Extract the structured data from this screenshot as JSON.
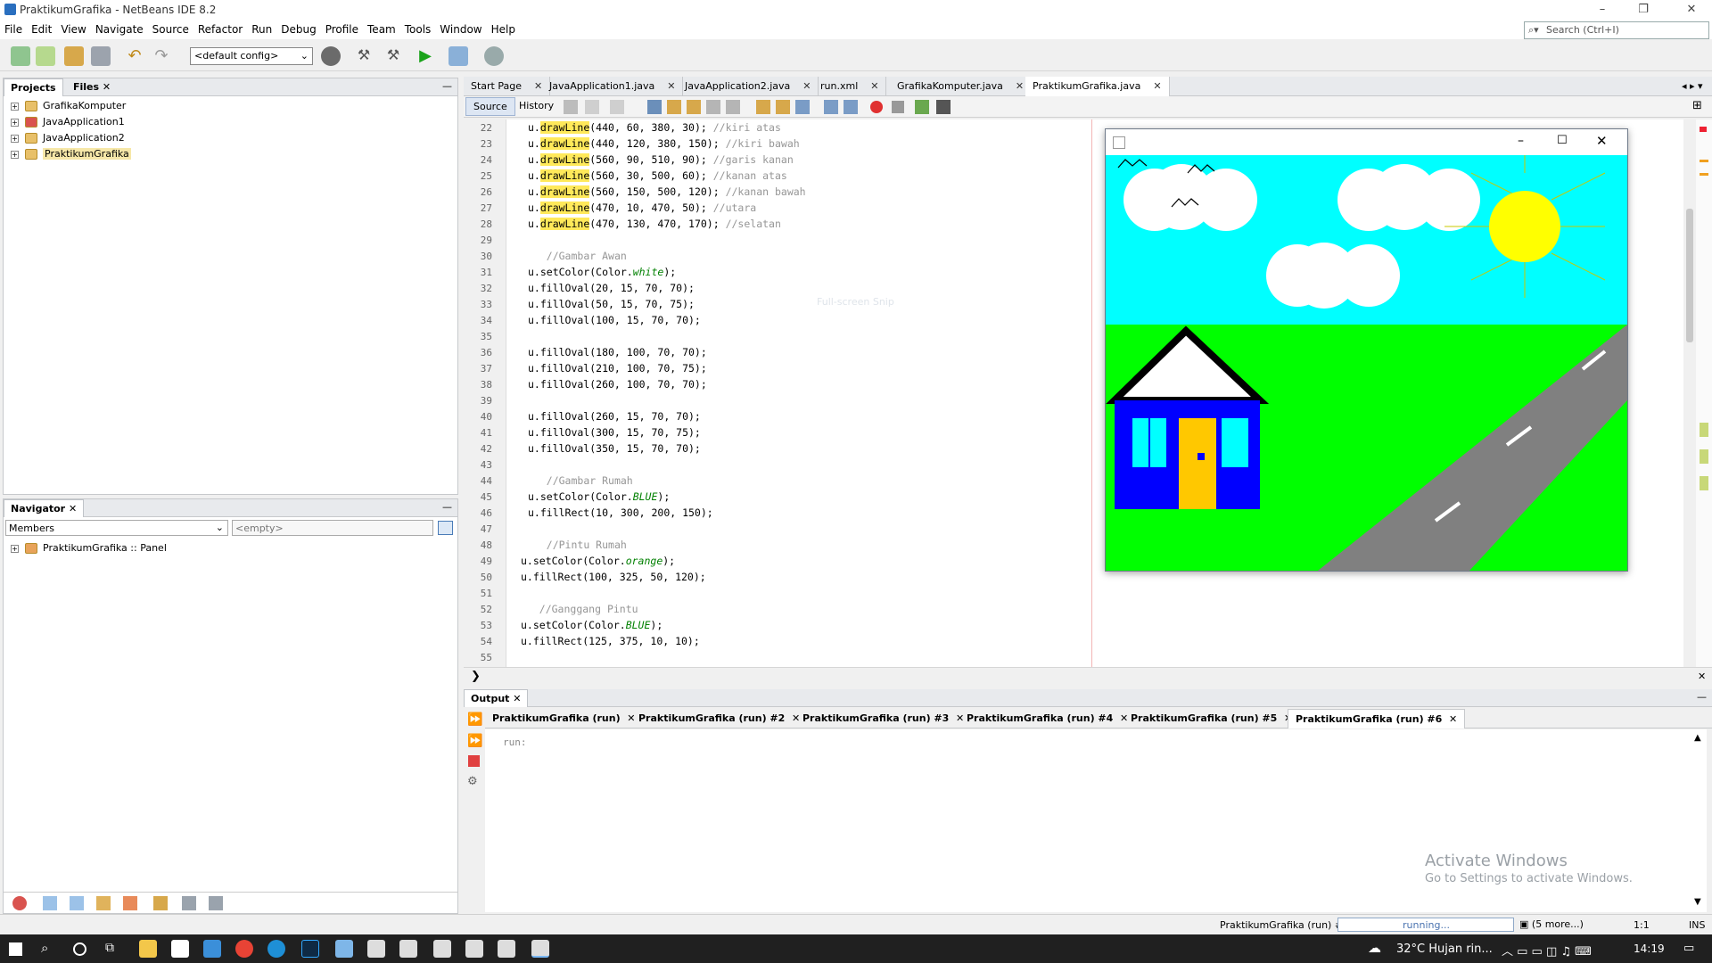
{
  "window": {
    "title": "PraktikumGrafika - NetBeans IDE 8.2"
  },
  "menu": [
    "File",
    "Edit",
    "View",
    "Navigate",
    "Source",
    "Refactor",
    "Run",
    "Debug",
    "Profile",
    "Team",
    "Tools",
    "Window",
    "Help"
  ],
  "search": {
    "placeholder": "Search (Ctrl+I)"
  },
  "toolbar": {
    "config": "<default config>"
  },
  "projects": {
    "tabs": [
      "Projects",
      "Files"
    ],
    "items": [
      "GrafikaKomputer",
      "JavaApplication1",
      "JavaApplication2",
      "PraktikumGrafika"
    ]
  },
  "navigator": {
    "title": "Navigator",
    "members": "Members",
    "filter": "<empty>",
    "node": "PraktikumGrafika :: Panel"
  },
  "editor": {
    "tabs": [
      "Start Page",
      "JavaApplication1.java",
      "JavaApplication2.java",
      "run.xml",
      "GrafikaKomputer.java",
      "PraktikumGrafika.java"
    ],
    "subtabs": [
      "Source",
      "History"
    ],
    "lines": [
      {
        "n": "22",
        "code": "u.drawLine(440, 60, 380, 30); //kiri atas"
      },
      {
        "n": "23",
        "code": "u.drawLine(440, 120, 380, 150); //kiri bawah"
      },
      {
        "n": "24",
        "code": "u.drawLine(560, 90, 510, 90); //garis kanan"
      },
      {
        "n": "25",
        "code": "u.drawLine(560, 30, 500, 60); //kanan atas"
      },
      {
        "n": "26",
        "code": "u.drawLine(560, 150, 500, 120); //kanan bawah"
      },
      {
        "n": "27",
        "code": "u.drawLine(470, 10, 470, 50); //utara"
      },
      {
        "n": "28",
        "code": "u.drawLine(470, 130, 470, 170); //selatan"
      },
      {
        "n": "29",
        "code": ""
      },
      {
        "n": "30",
        "code": "   //Gambar Awan"
      },
      {
        "n": "31",
        "code": "u.setColor(Color.white);"
      },
      {
        "n": "32",
        "code": "u.fillOval(20, 15, 70, 70);"
      },
      {
        "n": "33",
        "code": "u.fillOval(50, 15, 70, 75);"
      },
      {
        "n": "34",
        "code": "u.fillOval(100, 15, 70, 70);"
      },
      {
        "n": "35",
        "code": ""
      },
      {
        "n": "36",
        "code": "u.fillOval(180, 100, 70, 70);"
      },
      {
        "n": "37",
        "code": "u.fillOval(210, 100, 70, 75);"
      },
      {
        "n": "38",
        "code": "u.fillOval(260, 100, 70, 70);"
      },
      {
        "n": "39",
        "code": ""
      },
      {
        "n": "40",
        "code": "u.fillOval(260, 15, 70, 70);"
      },
      {
        "n": "41",
        "code": "u.fillOval(300, 15, 70, 75);"
      },
      {
        "n": "42",
        "code": "u.fillOval(350, 15, 70, 70);"
      },
      {
        "n": "43",
        "code": ""
      },
      {
        "n": "44",
        "code": "   //Gambar Rumah"
      },
      {
        "n": "45",
        "code": "u.setColor(Color.BLUE);"
      },
      {
        "n": "46",
        "code": "u.fillRect(10, 300, 200, 150);"
      },
      {
        "n": "47",
        "code": ""
      },
      {
        "n": "48",
        "code": "   //Pintu Rumah"
      },
      {
        "n": "49",
        "code": "u.setColor(Color.orange);"
      },
      {
        "n": "50",
        "code": "u.fillRect(100, 325, 50, 120);"
      },
      {
        "n": "51",
        "code": ""
      },
      {
        "n": "52",
        "code": "   //Ganggang Pintu"
      },
      {
        "n": "53",
        "code": "u.setColor(Color.BLUE);"
      },
      {
        "n": "54",
        "code": "u.fillRect(125, 375, 10, 10);"
      },
      {
        "n": "55",
        "code": ""
      }
    ],
    "watermark": "Full-screen Snip"
  },
  "output": {
    "title": "Output",
    "tabs": [
      "PraktikumGrafika (run)",
      "PraktikumGrafika (run) #2",
      "PraktikumGrafika (run) #3",
      "PraktikumGrafika (run) #4",
      "PraktikumGrafika (run) #5",
      "PraktikumGrafika (run) #6"
    ],
    "text": "run:"
  },
  "activation": {
    "title": "Activate Windows",
    "sub": "Go to Settings to activate Windows."
  },
  "status": {
    "task": "PraktikumGrafika (run) #6",
    "progress": "running...",
    "more": "(5 more...)",
    "pos": "1:1",
    "mode": "INS"
  },
  "taskbar": {
    "weather": "32°C  Hujan rin...",
    "time": "14:19"
  },
  "colors": {
    "sky": "#00ffff",
    "grass": "#00ff00",
    "house": "#0000ff",
    "door": "#ffc800",
    "sun": "#ffff00",
    "road": "#808080",
    "comment": "#969696"
  }
}
